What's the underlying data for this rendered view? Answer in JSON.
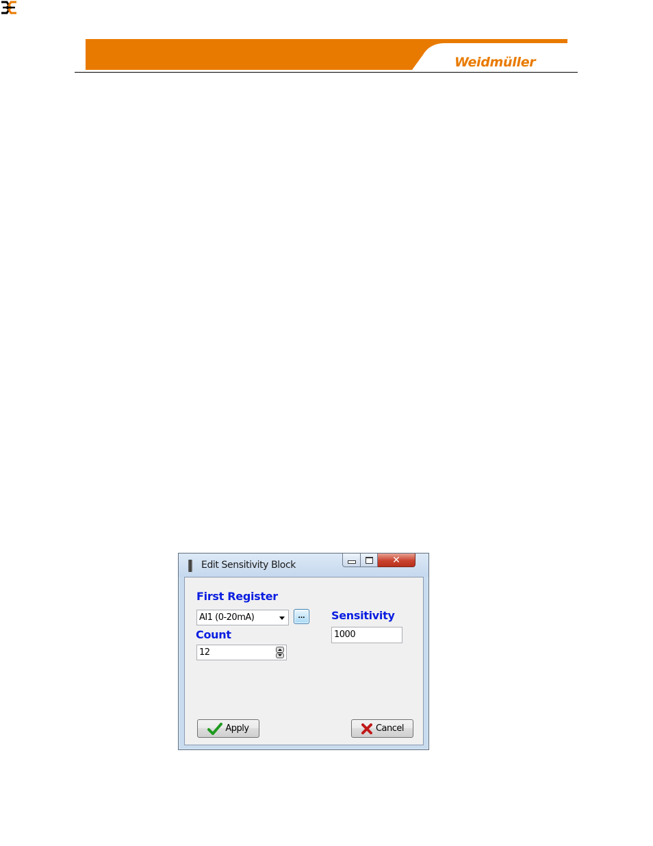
{
  "header": {
    "brand": "Weidmüller",
    "colors": {
      "banner": "#e97a00",
      "rule": "#000000"
    }
  },
  "dialog": {
    "title": "Edit Sensitivity Block",
    "window_buttons": [
      "minimize",
      "maximize",
      "close"
    ],
    "first_register": {
      "label": "First Register",
      "value": "AI1 (0-20mA)",
      "browse_label": "..."
    },
    "count": {
      "label": "Count",
      "value": "12"
    },
    "sensitivity": {
      "label": "Sensitivity",
      "value": "1000"
    },
    "apply_label": "Apply",
    "cancel_label": "Cancel",
    "colors": {
      "label_text": "#0a1ee0",
      "apply_icon": "#1e9a1e",
      "cancel_icon": "#c01818"
    }
  }
}
